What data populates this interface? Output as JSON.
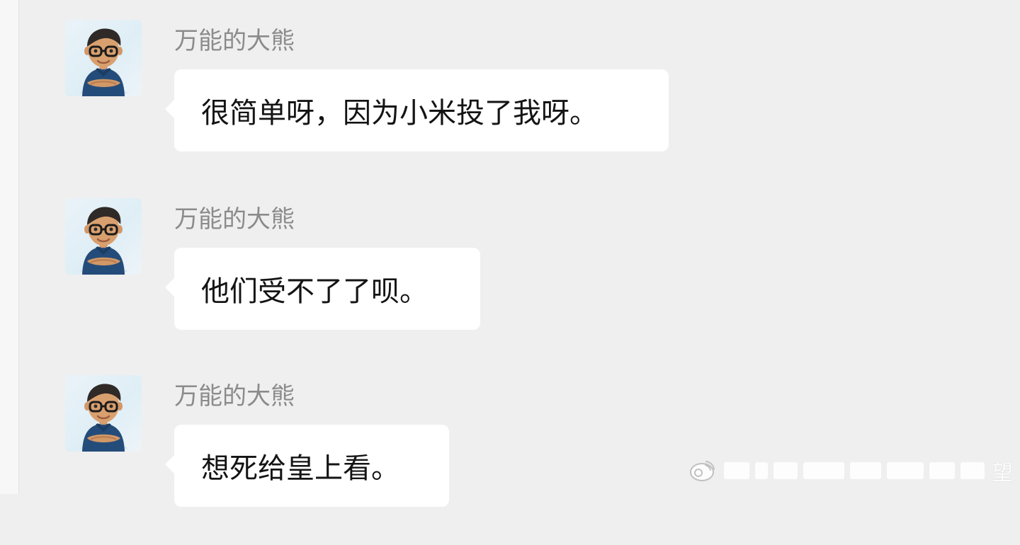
{
  "conversation": {
    "messages": [
      {
        "sender": "万能的大熊",
        "text": "很简单呀，因为小米投了我呀。",
        "avatar": "glasses-man-avatar"
      },
      {
        "sender": "万能的大熊",
        "text": "他们受不了了呗。",
        "avatar": "glasses-man-avatar"
      },
      {
        "sender": "万能的大熊",
        "text": "想死给皇上看。",
        "avatar": "glasses-man-avatar"
      }
    ]
  },
  "watermark": {
    "icon": "weibo-logo-icon",
    "text": "望"
  },
  "colors": {
    "background": "#efefef",
    "bubble": "#ffffff",
    "sender_name": "#8b8b8b",
    "message_text": "#141414",
    "avatar_shirt": "#244c7a"
  }
}
